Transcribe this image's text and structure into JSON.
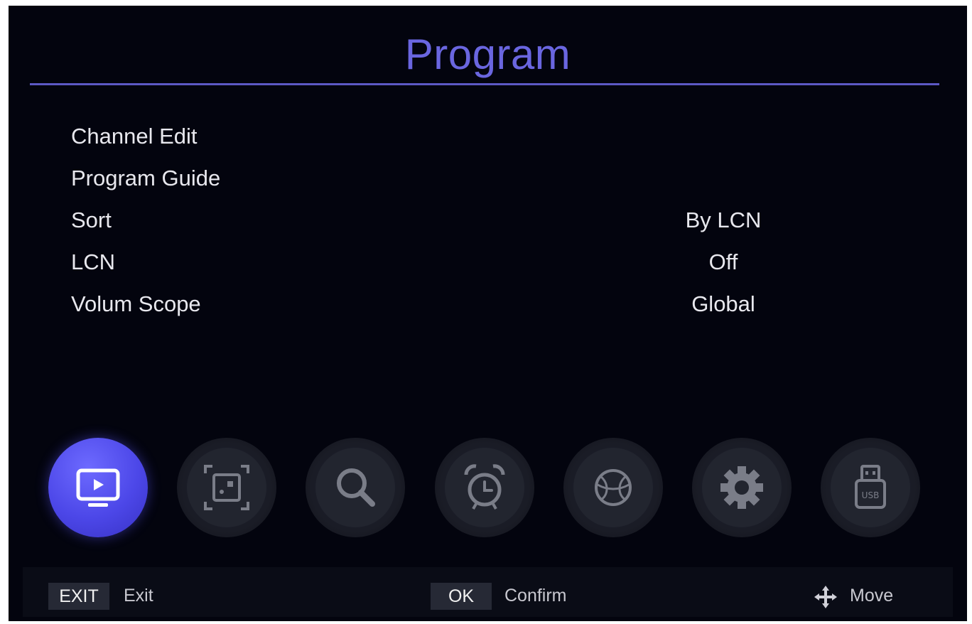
{
  "header": {
    "title": "Program"
  },
  "menu": {
    "items": [
      {
        "label": "Channel Edit",
        "value": ""
      },
      {
        "label": "Program Guide",
        "value": ""
      },
      {
        "label": "Sort",
        "value": "By LCN"
      },
      {
        "label": "LCN",
        "value": "Off"
      },
      {
        "label": "Volum Scope",
        "value": "Global"
      }
    ]
  },
  "icon_bar": {
    "icons": [
      {
        "name": "program-tv-icon",
        "active": true
      },
      {
        "name": "picture-icon",
        "active": false
      },
      {
        "name": "search-icon",
        "active": false
      },
      {
        "name": "alarm-clock-icon",
        "active": false
      },
      {
        "name": "globe-icon",
        "active": false
      },
      {
        "name": "gear-icon",
        "active": false
      },
      {
        "name": "usb-icon",
        "active": false
      }
    ]
  },
  "footer": {
    "exit_key": "EXIT",
    "exit_label": "Exit",
    "ok_key": "OK",
    "ok_label": "Confirm",
    "move_icon": "move-arrows-icon",
    "move_label": "Move"
  },
  "colors": {
    "background": "#03040e",
    "accent": "#6a66e0",
    "active_icon": "#4c47e8",
    "text": "#e8e8ee"
  }
}
